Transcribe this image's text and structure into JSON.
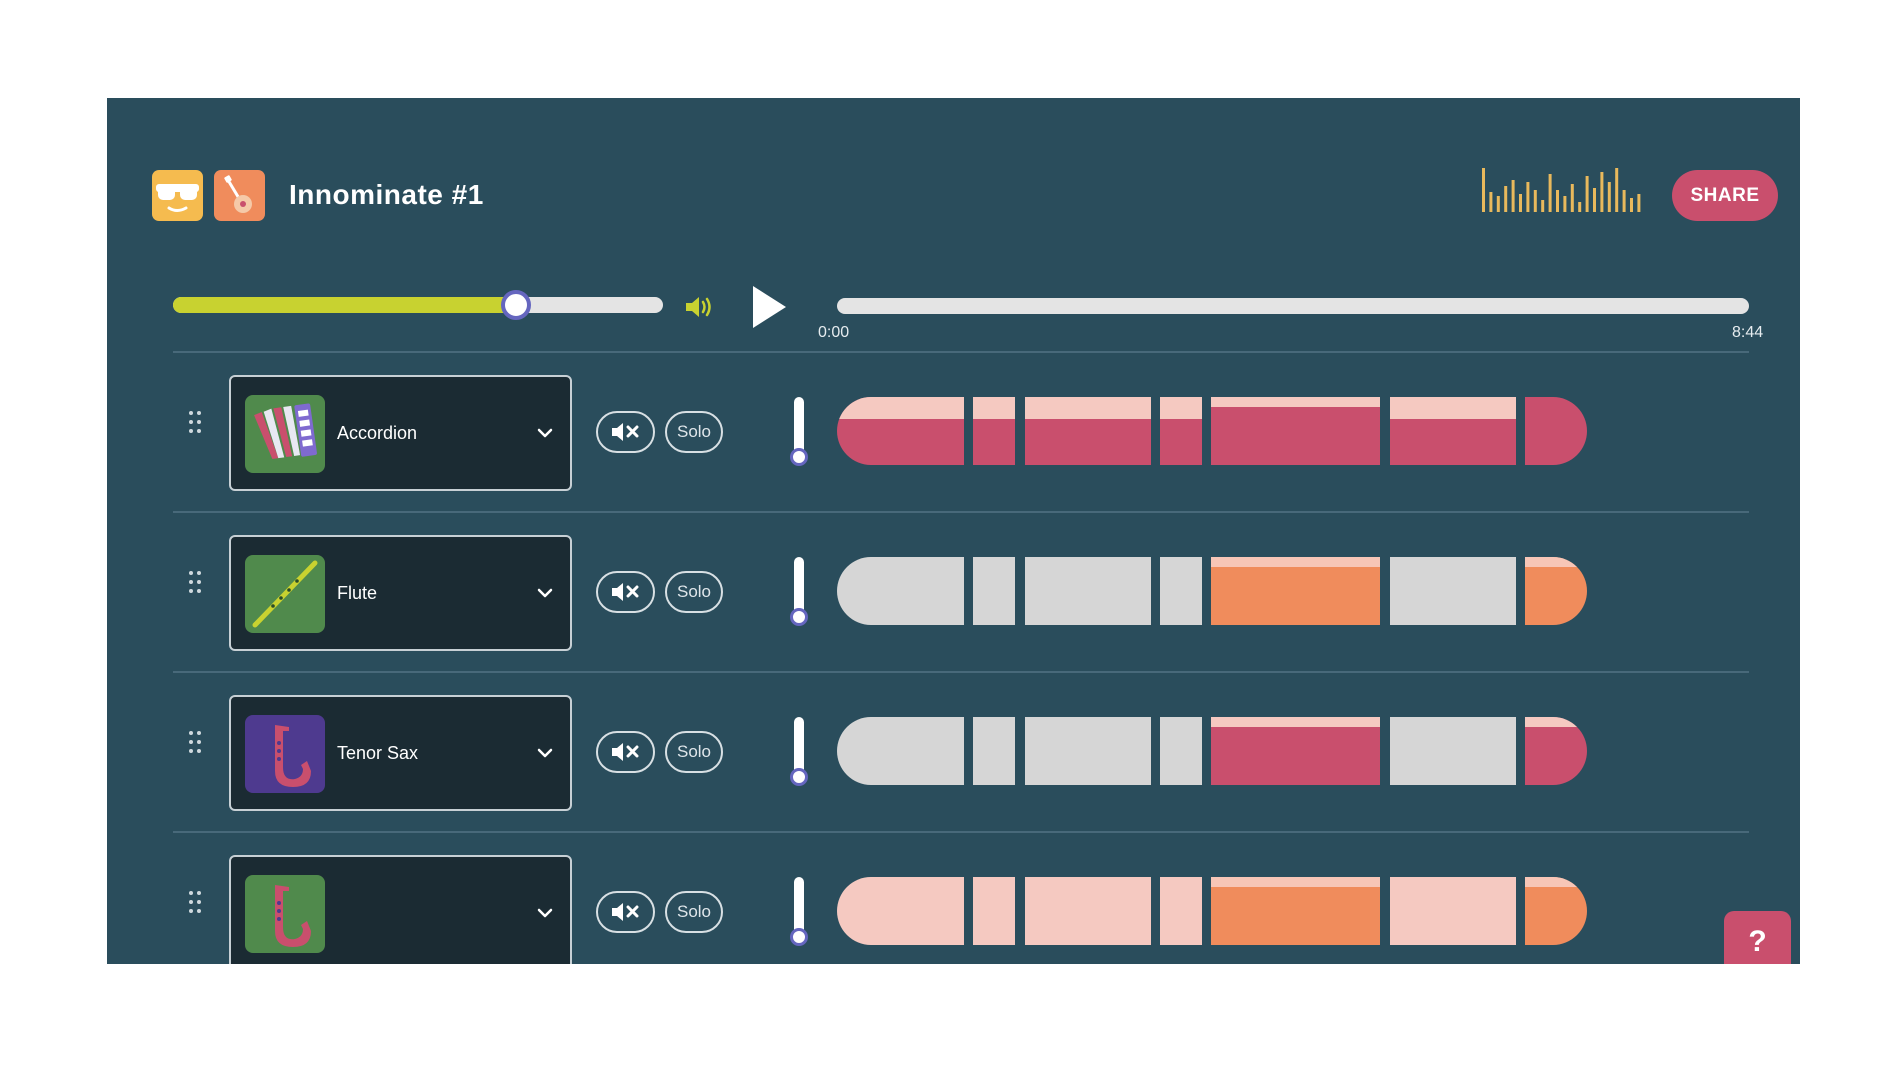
{
  "header": {
    "title": "Innominate #1",
    "share_label": "SHARE",
    "logo_icons": [
      "sunglasses-face-icon",
      "guitar-icon"
    ],
    "eq_icon": "equalizer-icon"
  },
  "transport": {
    "volume_level": 0.7,
    "speaker_icon": "speaker-icon",
    "play_icon": "play-icon",
    "time_start": "0:00",
    "time_end": "8:44",
    "progress": 0
  },
  "colors": {
    "background": "#2a4d5c",
    "accent_yellow": "#c8d230",
    "share_red": "#c94f6d",
    "pink_dark": "#c94f6d",
    "pink_light": "#f5c9c1",
    "orange": "#f08c5c",
    "orange_light": "#f7c6b7",
    "inactive": "#d6d6d6",
    "slider_thumb": "#6566bf"
  },
  "tracks": [
    {
      "name": "Accordion",
      "icon": "accordion-icon",
      "icon_bg": "#508a4c",
      "volume": 0.15,
      "segments": [
        "pink",
        "pink",
        "pink",
        "pink",
        "pink-high",
        "pink",
        "pink-full"
      ]
    },
    {
      "name": "Flute",
      "icon": "flute-icon",
      "icon_bg": "#508a4c",
      "volume": 0.15,
      "segments": [
        "gray",
        "gray",
        "gray",
        "gray",
        "orange",
        "gray",
        "orange"
      ]
    },
    {
      "name": "Tenor Sax",
      "icon": "saxophone-icon",
      "icon_bg": "#4e3a8f",
      "volume": 0.15,
      "segments": [
        "gray",
        "gray",
        "gray",
        "gray",
        "pink-high",
        "gray",
        "pink-high"
      ]
    },
    {
      "name": "",
      "icon": "saxophone-icon",
      "icon_bg": "#508a4c",
      "volume": 0.15,
      "segments": [
        "pink-light",
        "pink-light",
        "pink-light",
        "pink-light",
        "orange-high",
        "pink-light",
        "orange-high"
      ]
    }
  ],
  "help_label": "?"
}
